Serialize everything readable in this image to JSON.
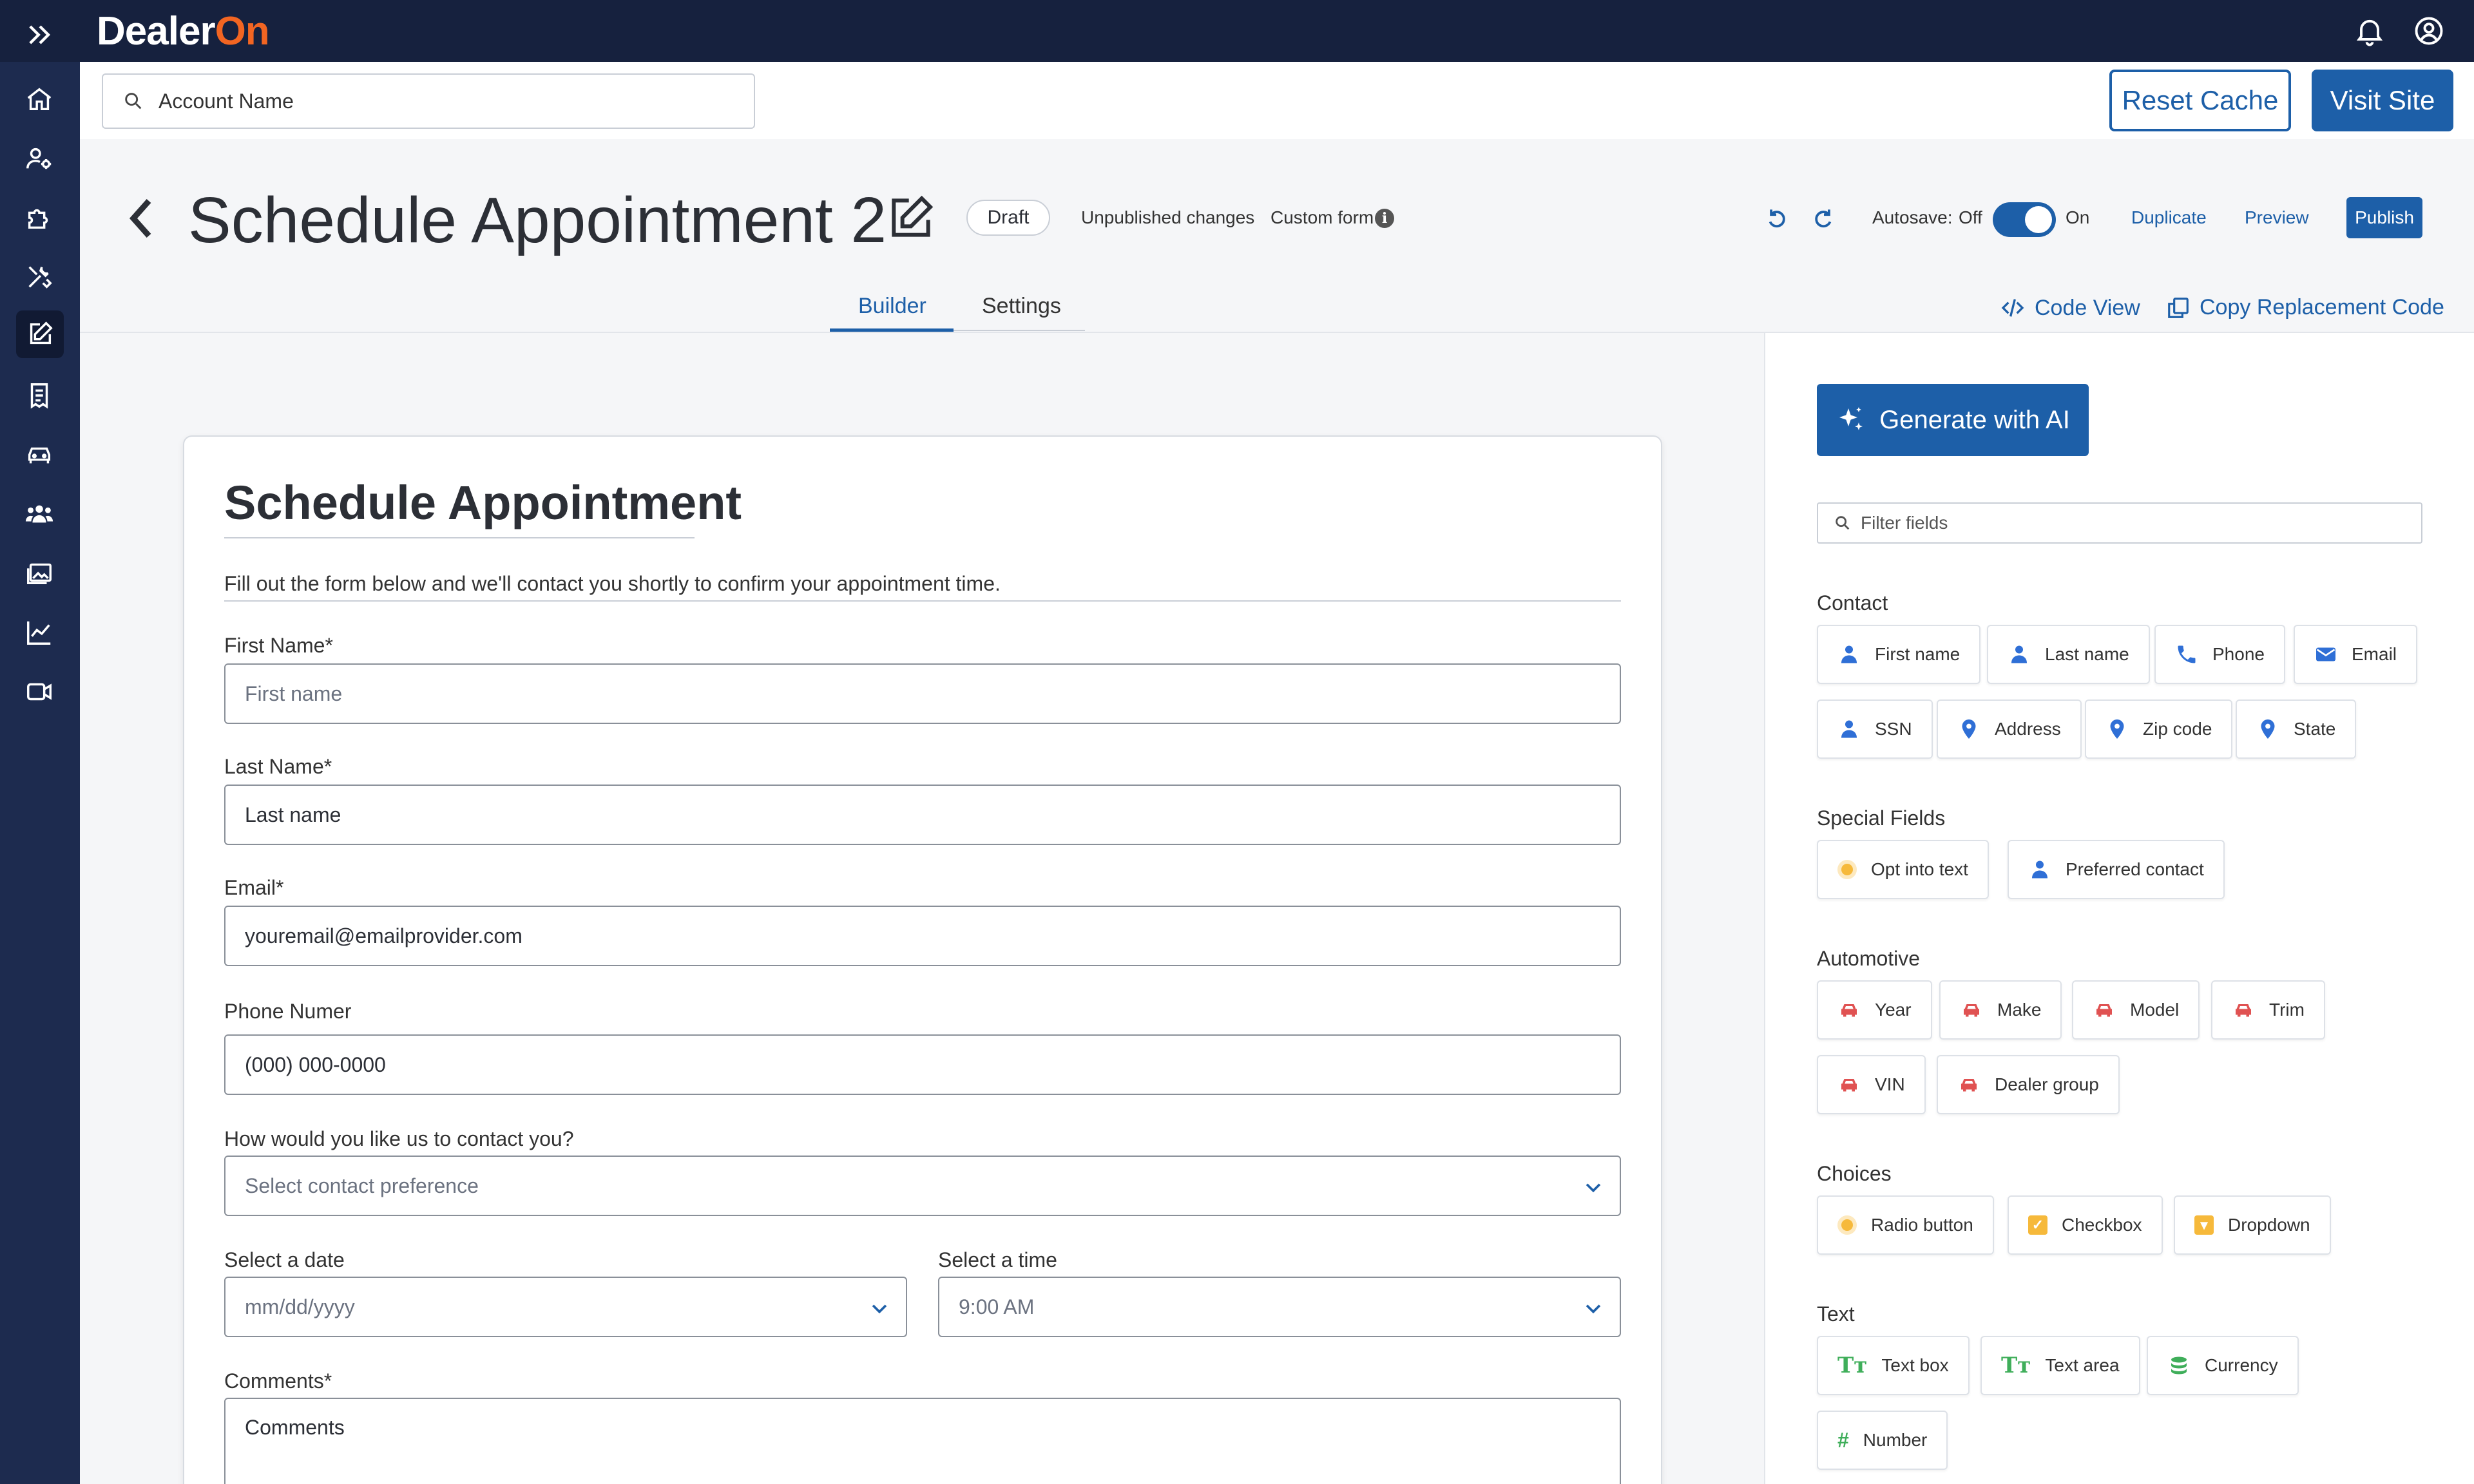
{
  "app": {
    "logo_text": "Dealer",
    "logo_accent": "On",
    "brand_color": "#1d5fa8",
    "accent_color": "#f26522"
  },
  "topbar": {
    "icons": [
      "expand-icon",
      "bell-icon",
      "user-circle-icon"
    ]
  },
  "leftnav": {
    "icons": [
      "home-icon",
      "user-settings-icon",
      "puzzle-icon",
      "tools-icon",
      "edit-icon",
      "receipt-icon",
      "car-icon",
      "people-icon",
      "image-icon",
      "chart-icon",
      "video-icon"
    ],
    "active": "edit-icon"
  },
  "account_search": {
    "placeholder": "Account Name"
  },
  "actions": {
    "reset_cache": "Reset Cache",
    "visit_site": "Visit Site"
  },
  "page": {
    "title": "Schedule Appointment 2",
    "status": "Draft",
    "unpublished": "Unpublished changes",
    "custom_form": "Custom form",
    "autosave_label": "Autosave:",
    "autosave_off": "Off",
    "autosave_on": "On",
    "autosave_enabled": true,
    "duplicate": "Duplicate",
    "preview": "Preview",
    "publish": "Publish"
  },
  "tabs": [
    {
      "label": "Builder",
      "active": true
    },
    {
      "label": "Settings",
      "active": false
    }
  ],
  "code_view": "Code View",
  "copy_code": "Copy Replacement Code",
  "form": {
    "title": "Schedule Appointment",
    "description": "Fill out the form below and we'll contact you shortly to confirm your appointment time.",
    "fields": {
      "first_name": {
        "label": "First Name*",
        "placeholder": "First name"
      },
      "last_name": {
        "label": "Last Name*",
        "value": "Last name"
      },
      "email": {
        "label": "Email*",
        "value": "youremail@emailprovider.com"
      },
      "phone": {
        "label": "Phone Numer",
        "value": "(000) 000-0000"
      },
      "contact_pref": {
        "label": "How would you like us to contact you?",
        "placeholder": "Select contact preference"
      },
      "date": {
        "label": "Select a date",
        "placeholder": "mm/dd/yyyy"
      },
      "time": {
        "label": "Select a time",
        "value": "9:00 AM"
      },
      "comments": {
        "label": "Comments*",
        "value": "Comments"
      }
    }
  },
  "panel": {
    "ai_button": "Generate with AI",
    "filter_placeholder": "Filter fields",
    "sections": {
      "contact": {
        "title": "Contact",
        "items": [
          "First name",
          "Last name",
          "Phone",
          "Email",
          "SSN",
          "Address",
          "Zip code",
          "State"
        ]
      },
      "special": {
        "title": "Special Fields",
        "items": [
          "Opt into text",
          "Preferred contact"
        ]
      },
      "automotive": {
        "title": "Automotive",
        "items": [
          "Year",
          "Make",
          "Model",
          "Trim",
          "VIN",
          "Dealer group"
        ]
      },
      "choices": {
        "title": "Choices",
        "items": [
          "Radio button",
          "Checkbox",
          "Dropdown"
        ]
      },
      "text": {
        "title": "Text",
        "items": [
          "Text box",
          "Text area",
          "Currency",
          "Number"
        ]
      }
    }
  }
}
